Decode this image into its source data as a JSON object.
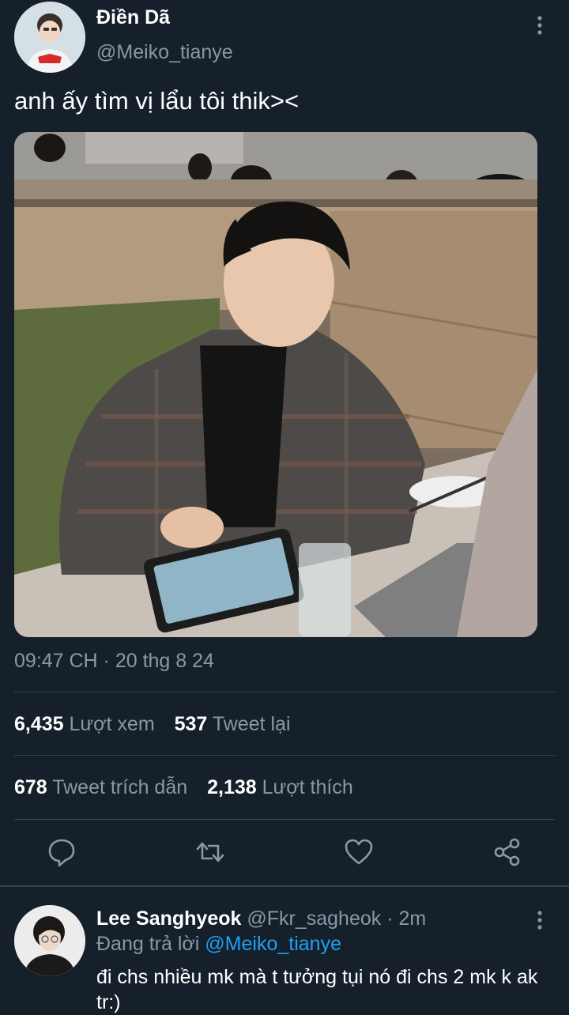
{
  "tweet": {
    "display_name": "Điền Dã",
    "handle": "@Meiko_tianye",
    "text": "anh ấy tìm vị lẩu tôi thik><",
    "timestamp": "09:47 CH · 20 thg 8 24",
    "stats": {
      "views_count": "6,435",
      "views_label": "Lượt xem",
      "retweets_count": "537",
      "retweets_label": "Tweet lại",
      "quotes_count": "678",
      "quotes_label": "Tweet trích dẫn",
      "likes_count": "2,138",
      "likes_label": "Lượt thích"
    },
    "actions": [
      "reply-icon",
      "retweet-icon",
      "like-icon",
      "share-icon"
    ]
  },
  "reply": {
    "display_name": "Lee Sanghyeok",
    "handle_time": "@Fkr_sagheok · 2m",
    "replying_prefix": "Đang trả lời",
    "replying_to": "@Meiko_tianye",
    "text": "đi chs nhiều mk mà t tưởng tụi nó đi chs 2 mk k ak tr:)"
  },
  "colors": {
    "background": "#15202b",
    "secondary_text": "#8899a6",
    "mention": "#1da1f2",
    "divider": "#38444d"
  }
}
